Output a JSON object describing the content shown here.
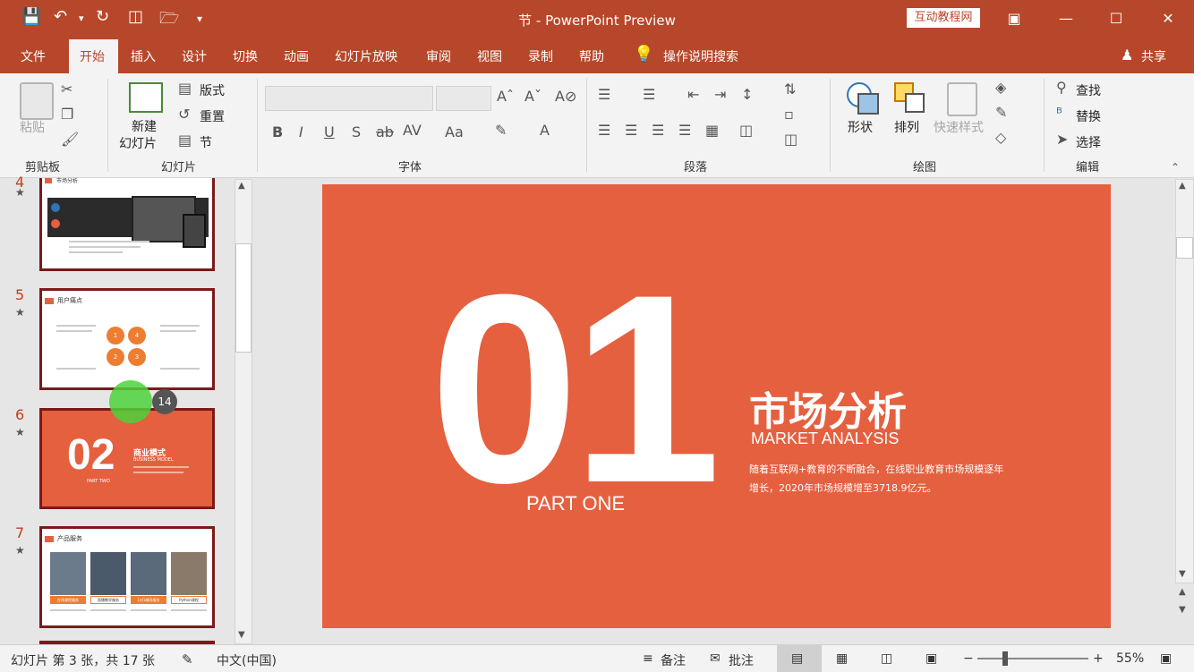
{
  "window": {
    "title": "节 - PowerPoint Preview",
    "tutorial_badge": "互动教程网",
    "share_label": "共享"
  },
  "tabs": [
    "文件",
    "开始",
    "插入",
    "设计",
    "切换",
    "动画",
    "幻灯片放映",
    "审阅",
    "视图",
    "录制",
    "帮助"
  ],
  "tell_me": "操作说明搜索",
  "ribbon": {
    "clipboard": {
      "paste": "粘贴",
      "group": "剪贴板"
    },
    "slides": {
      "new_slide_1": "新建",
      "new_slide_2": "幻灯片",
      "layout": "版式",
      "reset": "重置",
      "section": "节",
      "group": "幻灯片"
    },
    "font": {
      "group": "字体"
    },
    "paragraph": {
      "group": "段落"
    },
    "drawing": {
      "shapes": "形状",
      "arrange": "排列",
      "quick_styles": "快速样式",
      "group": "绘图"
    },
    "editing": {
      "find": "查找",
      "replace": "替换",
      "select": "选择",
      "group": "编辑"
    }
  },
  "thumbnails": [
    {
      "num": "4",
      "title": "市场分析"
    },
    {
      "num": "5",
      "title": "用户痛点",
      "nodes": [
        "1",
        "4",
        "2",
        "3"
      ]
    },
    {
      "num": "6",
      "big": "02",
      "title": "商业模式",
      "sub": "BUSINESS MODEL",
      "part": "PART TWO"
    },
    {
      "num": "7",
      "title": "产品服务",
      "cards": [
        "在线课程服务",
        "直播教学服务",
        "1对1辅导服务",
        "Python课程"
      ]
    }
  ],
  "click_badge": "14",
  "slide": {
    "big_number": "01",
    "part": "PART ONE",
    "heading": "市场分析",
    "subheading": "MARKET ANALYSIS",
    "body_line1": "随着互联网+教育的不断融合，在线职业教育市场规模逐年",
    "body_line2": "增长，2020年市场规模增至3718.9亿元。",
    "bg_color": "#e5603f"
  },
  "status": {
    "slide_info": "幻灯片 第 3 张，共 17 张",
    "language": "中文(中国)",
    "notes": "备注",
    "comments": "批注",
    "zoom": "55%"
  }
}
